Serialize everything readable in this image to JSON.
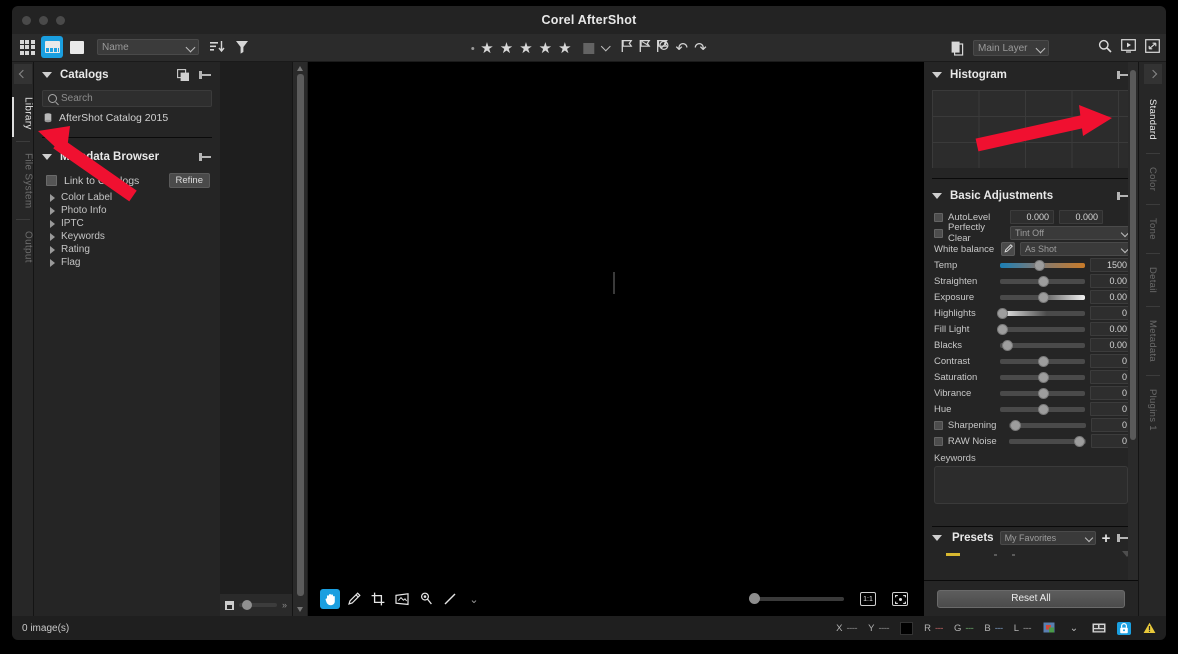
{
  "window": {
    "title": "Corel AfterShot"
  },
  "toolbar": {
    "view_modes": [
      {
        "name": "grid-view",
        "active": false
      },
      {
        "name": "filmstrip-view",
        "active": true
      },
      {
        "name": "single-view",
        "active": false
      }
    ],
    "sort_field": "Name",
    "sort_icon": "sort-descending-icon",
    "filter_icon": "filter-funnel-icon",
    "rating_stars": 5,
    "color_label_icon": "color-label-swatch",
    "flags": [
      "flag-pick-icon",
      "flag-unpick-icon",
      "flag-reject-icon"
    ],
    "undo_icon": "undo-icon",
    "redo_icon": "redo-icon",
    "layer_icon": "layers-icon",
    "layer_value": "Main Layer",
    "search_icon": "search-icon",
    "slideshow_icon": "slideshow-icon",
    "fullscreen_icon": "fullscreen-icon"
  },
  "left_rail": {
    "collapse_icon": "collapse-left-icon",
    "tabs": [
      {
        "label": "Library",
        "active": true
      },
      {
        "label": "File System",
        "active": false
      },
      {
        "label": "Output",
        "active": false
      }
    ]
  },
  "catalogs": {
    "title": "Catalogs",
    "copy_icon": "duplicate-icon",
    "pin_icon": "pin-icon",
    "search_placeholder": "Search",
    "items": [
      {
        "label": "AfterShot Catalog 2015",
        "icon": "database-icon"
      }
    ]
  },
  "metadata_browser": {
    "title": "Metadata Browser",
    "pin_icon": "pin-icon",
    "link_to_catalogs_label": "Link to Catalogs",
    "refine_label": "Refine",
    "tree": [
      "Color Label",
      "Photo Info",
      "IPTC",
      "Keywords",
      "Rating",
      "Flag"
    ]
  },
  "filmstrip": {
    "thumb_icon": "thumbnail-size-icon",
    "expand_icon": "double-chevron-right-icon"
  },
  "canvas_tools": {
    "items": [
      {
        "name": "hand-tool",
        "glyph": "✋",
        "active": true
      },
      {
        "name": "heal-brush-tool",
        "glyph": "✒",
        "active": false
      },
      {
        "name": "crop-tool",
        "glyph": "⌗",
        "active": false
      },
      {
        "name": "perspective-tool",
        "glyph": "◰",
        "active": false
      },
      {
        "name": "redeye-tool",
        "glyph": "⚲",
        "active": false
      },
      {
        "name": "straighten-tool",
        "glyph": "╱",
        "active": false
      },
      {
        "name": "tool-overflow-chevron",
        "glyph": "⌄",
        "active": false
      }
    ],
    "zoom_1to1_label": "1:1",
    "zoom_fit_label": "fit"
  },
  "histogram": {
    "title": "Histogram",
    "pin_icon": "pin-icon"
  },
  "basic_adjustments": {
    "title": "Basic Adjustments",
    "pin_icon": "pin-icon",
    "autolevel_label": "AutoLevel",
    "autolevel_value_1": "0.000",
    "autolevel_value_2": "0.000",
    "perfectly_clear_label": "Perfectly Clear",
    "tint_value": "Tint Off",
    "white_balance_label": "White balance",
    "eyedropper_icon": "eyedropper-icon",
    "white_balance_value": "As Shot",
    "sliders": [
      {
        "label": "Temp",
        "value": "1500",
        "pos": 46,
        "style": "temp",
        "checkbox": false
      },
      {
        "label": "Straighten",
        "value": "0.00",
        "pos": 50,
        "style": "plain",
        "checkbox": false
      },
      {
        "label": "Exposure",
        "value": "0.00",
        "pos": 50,
        "style": "expo",
        "checkbox": false
      },
      {
        "label": "Highlights",
        "value": "0",
        "pos": 2,
        "style": "high",
        "checkbox": false
      },
      {
        "label": "Fill Light",
        "value": "0.00",
        "pos": 2,
        "style": "plain",
        "checkbox": false
      },
      {
        "label": "Blacks",
        "value": "0.00",
        "pos": 8,
        "style": "plain",
        "checkbox": false
      },
      {
        "label": "Contrast",
        "value": "0",
        "pos": 50,
        "style": "plain",
        "checkbox": false
      },
      {
        "label": "Saturation",
        "value": "0",
        "pos": 50,
        "style": "plain",
        "checkbox": false
      },
      {
        "label": "Vibrance",
        "value": "0",
        "pos": 50,
        "style": "plain",
        "checkbox": false
      },
      {
        "label": "Hue",
        "value": "0",
        "pos": 50,
        "style": "plain",
        "checkbox": false
      },
      {
        "label": "Sharpening",
        "value": "0",
        "pos": 8,
        "style": "plain",
        "checkbox": true
      },
      {
        "label": "RAW Noise",
        "value": "0",
        "pos": 92,
        "style": "plain",
        "checkbox": true
      }
    ],
    "keywords_label": "Keywords",
    "keywords_value": ""
  },
  "presets": {
    "title": "Presets",
    "selected": "My Favorites",
    "add_icon": "plus-icon",
    "pin_icon": "pin-icon"
  },
  "reset": {
    "label": "Reset All"
  },
  "right_rail": {
    "collapse_icon": "collapse-right-icon",
    "tabs": [
      {
        "label": "Standard",
        "active": true
      },
      {
        "label": "Color",
        "active": false
      },
      {
        "label": "Tone",
        "active": false
      },
      {
        "label": "Detail",
        "active": false
      },
      {
        "label": "Metadata",
        "active": false
      },
      {
        "label": "Plugins 1",
        "active": false
      }
    ]
  },
  "statusbar": {
    "image_count": "0 image(s)",
    "x_label": "X",
    "x_value": "----",
    "y_label": "Y",
    "y_value": "----",
    "r_label": "R",
    "r_value": "---",
    "g_label": "G",
    "g_value": "---",
    "b_label": "B",
    "b_value": "---",
    "l_label": "L",
    "l_value": "---",
    "color_profile_icon": "color-profile-icon",
    "chevron_icon": "chevron-down-icon",
    "proof_icon": "soft-proof-icon",
    "lock_icon": "lock-icon",
    "warning_icon": "warning-icon"
  },
  "colors": {
    "accent": "#1a9fe0",
    "panel": "#252525",
    "rail": "#272727",
    "r": "#c06464",
    "g": "#6aa86a",
    "b": "#7a9ac0",
    "l": "#9a9a9a",
    "warning": "#e8c93a",
    "preset_marker": "#d8b830"
  },
  "annotation": {
    "arrows": [
      {
        "name": "arrow-left-sidebar",
        "color": "#f01030"
      },
      {
        "name": "arrow-histogram",
        "color": "#f01030"
      }
    ]
  }
}
